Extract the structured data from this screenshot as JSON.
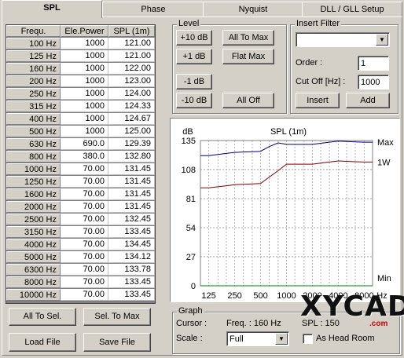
{
  "tabs": [
    {
      "label": "SPL"
    },
    {
      "label": "Phase"
    },
    {
      "label": "Nyquist"
    },
    {
      "label": "DLL / GLL Setup"
    }
  ],
  "table": {
    "headers": [
      "Frequ.",
      "Ele.Power",
      "SPL (1m)"
    ],
    "rows": [
      {
        "freq": "100 Hz",
        "power": "1000",
        "spl": "121.00"
      },
      {
        "freq": "125 Hz",
        "power": "1000",
        "spl": "121.00"
      },
      {
        "freq": "160 Hz",
        "power": "1000",
        "spl": "122.00"
      },
      {
        "freq": "200 Hz",
        "power": "1000",
        "spl": "123.00"
      },
      {
        "freq": "250 Hz",
        "power": "1000",
        "spl": "124.00"
      },
      {
        "freq": "315 Hz",
        "power": "1000",
        "spl": "124.33"
      },
      {
        "freq": "400 Hz",
        "power": "1000",
        "spl": "124.67"
      },
      {
        "freq": "500 Hz",
        "power": "1000",
        "spl": "125.00"
      },
      {
        "freq": "630 Hz",
        "power": "690.0",
        "spl": "129.39"
      },
      {
        "freq": "800 Hz",
        "power": "380.0",
        "spl": "132.80"
      },
      {
        "freq": "1000 Hz",
        "power": "70.00",
        "spl": "131.45"
      },
      {
        "freq": "1250 Hz",
        "power": "70.00",
        "spl": "131.45"
      },
      {
        "freq": "1600 Hz",
        "power": "70.00",
        "spl": "131.45"
      },
      {
        "freq": "2000 Hz",
        "power": "70.00",
        "spl": "131.45"
      },
      {
        "freq": "2500 Hz",
        "power": "70.00",
        "spl": "132.45"
      },
      {
        "freq": "3150 Hz",
        "power": "70.00",
        "spl": "133.45"
      },
      {
        "freq": "4000 Hz",
        "power": "70.00",
        "spl": "134.45"
      },
      {
        "freq": "5000 Hz",
        "power": "70.00",
        "spl": "134.12"
      },
      {
        "freq": "6300 Hz",
        "power": "70.00",
        "spl": "133.78"
      },
      {
        "freq": "8000 Hz",
        "power": "70.00",
        "spl": "133.45"
      },
      {
        "freq": "10000 Hz",
        "power": "70.00",
        "spl": "133.45"
      }
    ]
  },
  "buttons": {
    "all_to_sel": "All To Sel.",
    "sel_to_max": "Sel. To Max",
    "load_file": "Load File",
    "save_file": "Save File"
  },
  "level": {
    "title": "Level",
    "plus10": "+10 dB",
    "plus1": "+1 dB",
    "minus1": "-1 dB",
    "minus10": "-10 dB",
    "all_to_max": "All To Max",
    "flat_max": "Flat Max",
    "all_off": "All Off"
  },
  "insert_filter": {
    "title": "Insert Filter",
    "type_value": "",
    "order_label": "Order :",
    "order_value": "1",
    "cutoff_label": "Cut Off [Hz] :",
    "cutoff_value": "1000",
    "insert": "Insert",
    "add": "Add"
  },
  "graph": {
    "title": "Graph",
    "cursor_label": "Cursor :",
    "cursor_freq": "Freq. : 160 Hz",
    "cursor_spl": "SPL : 150",
    "scale_label": "Scale :",
    "scale_value": "Full",
    "head_room_label": "As Head Room",
    "head_room_checked": false
  },
  "watermark": "XYCAD.com",
  "colors": {
    "max_line": "#000080",
    "w1_line": "#800000",
    "min_line": "#008000",
    "grid": "#808080"
  },
  "chart_data": {
    "type": "line",
    "title": "SPL (1m)",
    "ylabel": "dB",
    "xlabel": "Hz",
    "ylim": [
      0,
      135
    ],
    "y_ticks": [
      0,
      27,
      54,
      81,
      108,
      135
    ],
    "x_tick_labels": [
      "125",
      "250",
      "500",
      "1000",
      "2000",
      "4000",
      "8000"
    ],
    "x_tick_values": [
      125,
      250,
      500,
      1000,
      2000,
      4000,
      8000
    ],
    "xlim": [
      100,
      10000
    ],
    "x": [
      100,
      125,
      160,
      200,
      250,
      315,
      400,
      500,
      630,
      800,
      1000,
      1250,
      1600,
      2000,
      2500,
      3150,
      4000,
      5000,
      6300,
      8000,
      10000
    ],
    "series": [
      {
        "name": "Max",
        "color": "#000080",
        "values": [
          121.0,
          121.0,
          122.0,
          123.0,
          124.0,
          124.33,
          124.67,
          125.0,
          129.39,
          132.8,
          131.45,
          131.45,
          131.45,
          131.45,
          132.45,
          133.45,
          134.45,
          134.12,
          133.78,
          133.45,
          133.45
        ]
      },
      {
        "name": "1W",
        "color": "#800000",
        "values": [
          91.0,
          91.0,
          92.0,
          93.0,
          94.0,
          94.33,
          94.67,
          95.0,
          101.0,
          107.0,
          113.0,
          113.0,
          113.0,
          113.0,
          114.0,
          115.0,
          116.0,
          115.67,
          115.33,
          115.0,
          115.0
        ]
      },
      {
        "name": "Min",
        "color": "#008000",
        "values": [
          0,
          0,
          0,
          0,
          0,
          0,
          0,
          0,
          0,
          0,
          0,
          0,
          0,
          0,
          0,
          0,
          0,
          0,
          0,
          0,
          0
        ]
      }
    ]
  }
}
